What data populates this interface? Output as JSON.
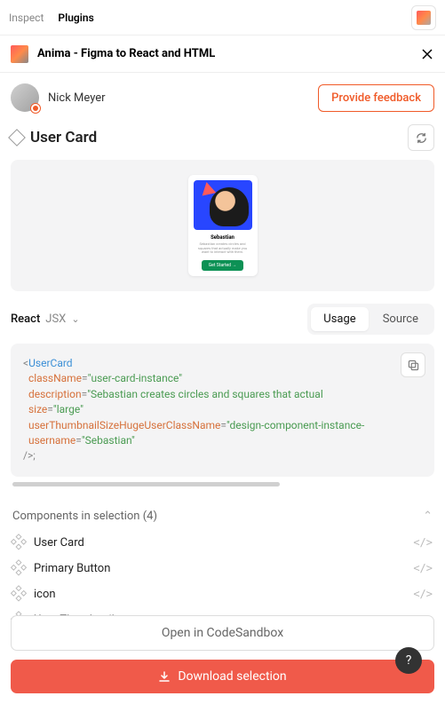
{
  "topbar": {
    "inspect": "Inspect",
    "plugins": "Plugins"
  },
  "header": {
    "title": "Anima - Figma to React and HTML"
  },
  "user": {
    "name": "Nick Meyer",
    "feedback": "Provide feedback"
  },
  "page": {
    "title": "User Card"
  },
  "preview": {
    "card_name": "Sebastian",
    "card_desc": "Sebastian creates circles and squares that actually make you want to interact with them.",
    "card_cta": "Get Started →"
  },
  "lang": {
    "framework": "React",
    "syntax": "JSX"
  },
  "segments": {
    "usage": "Usage",
    "source": "Source"
  },
  "code": {
    "tag": "UserCard",
    "attrs": {
      "className": "user-card-instance",
      "description": "Sebastian creates circles and squares that actual",
      "size": "large",
      "userThumbnailSizeHugeUserClassName": "design-component-instance-",
      "username": "Sebastian"
    }
  },
  "components": {
    "heading": "Components in selection (4)",
    "items": [
      "User Card",
      "Primary Button",
      "icon",
      "User Thumbnail"
    ]
  },
  "actions": {
    "codesandbox": "Open in CodeSandbox",
    "download": "Download selection"
  },
  "help": "?"
}
